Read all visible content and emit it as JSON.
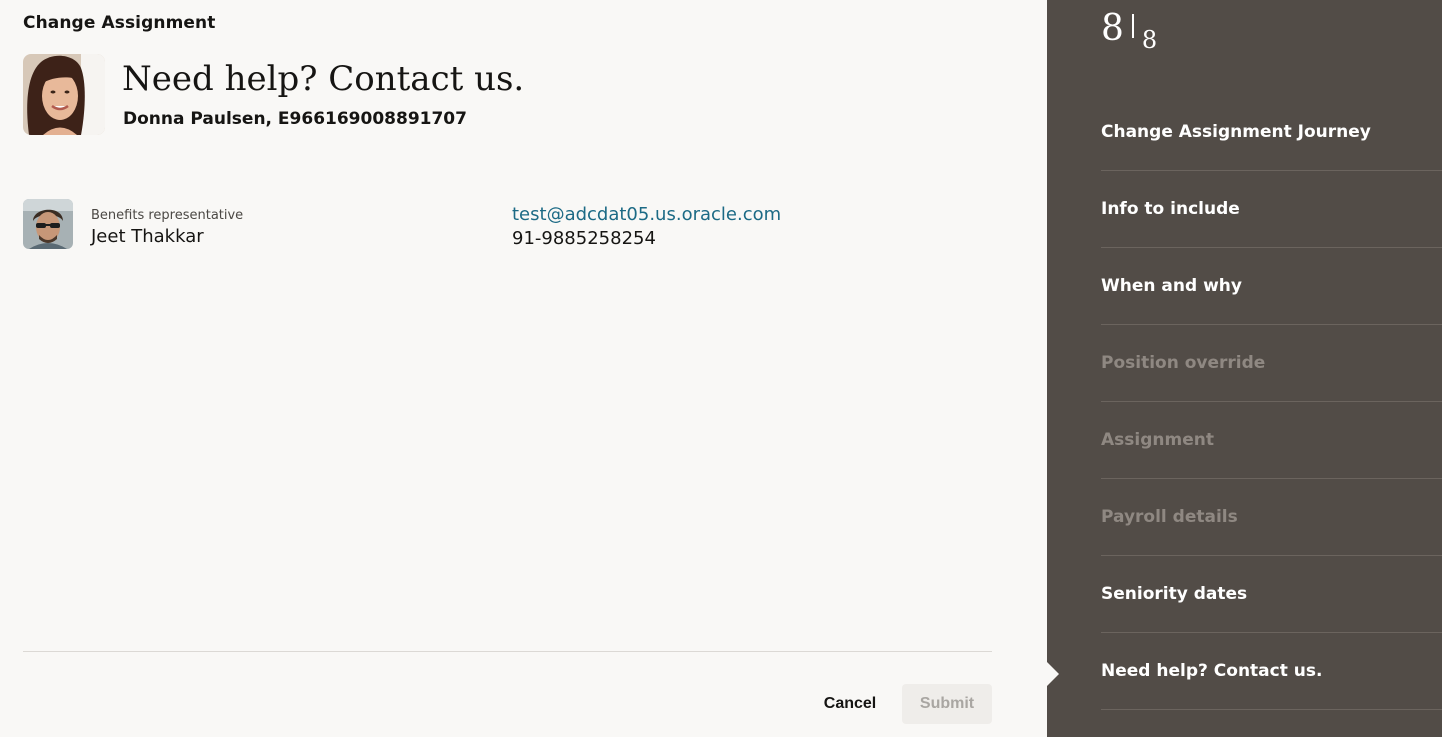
{
  "header": {
    "app_title": "Change Assignment"
  },
  "person": {
    "heading": "Need help? Contact us.",
    "name_and_id": "Donna Paulsen, E966169008891707"
  },
  "contact": {
    "role": "Benefits representative",
    "name": "Jeet Thakkar",
    "email": "test@adcdat05.us.oracle.com",
    "phone": "91-9885258254"
  },
  "footer": {
    "cancel_label": "Cancel",
    "submit_label": "Submit"
  },
  "steps": {
    "current": "8",
    "total": "8",
    "items": [
      {
        "label": "Change Assignment Journey",
        "enabled": true
      },
      {
        "label": "Info to include",
        "enabled": true
      },
      {
        "label": "When and why",
        "enabled": true
      },
      {
        "label": "Position override",
        "enabled": false
      },
      {
        "label": "Assignment",
        "enabled": false
      },
      {
        "label": "Payroll details",
        "enabled": false
      },
      {
        "label": "Seniority dates",
        "enabled": true
      },
      {
        "label": "Need help? Contact us.",
        "enabled": true,
        "current": true
      }
    ]
  },
  "colors": {
    "page_background": "#f9f8f6",
    "sidebar_background": "#524c47",
    "link": "#1c6a85",
    "disabled_step": "#8f8882"
  },
  "icons": {
    "person_avatar": "woman-portrait-avatar",
    "contact_avatar": "man-sunglasses-avatar",
    "current_step_marker": "caret-right-icon"
  }
}
